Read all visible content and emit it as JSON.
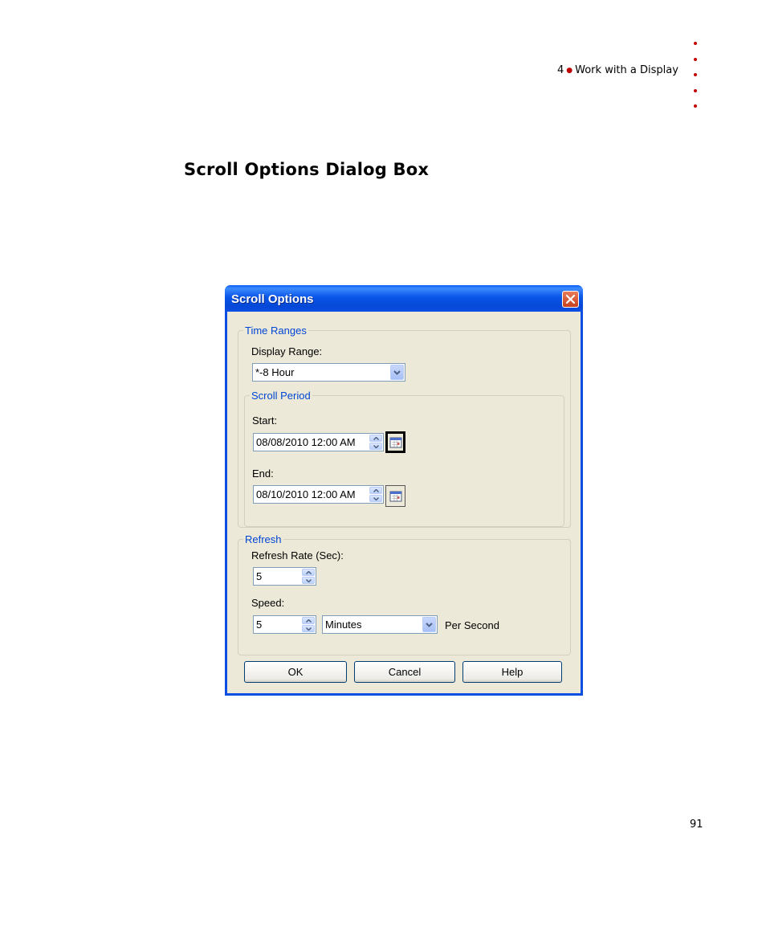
{
  "page_header": {
    "chapter_number": "4",
    "bullet": "●",
    "chapter_title": "Work with a Display"
  },
  "section_title": "Scroll Options Dialog Box",
  "page_number": "91",
  "dialog": {
    "title": "Scroll Options",
    "time_ranges": {
      "legend": "Time Ranges",
      "display_range_label": "Display Range:",
      "display_range_value": "*-8 Hour",
      "scroll_period": {
        "legend": "Scroll Period",
        "start_label": "Start:",
        "start_value": "08/08/2010 12:00 AM",
        "end_label": "End:",
        "end_value": "08/10/2010 12:00 AM"
      }
    },
    "refresh": {
      "legend": "Refresh",
      "rate_label": "Refresh Rate (Sec):",
      "rate_value": "5",
      "speed_label": "Speed:",
      "speed_value": "5",
      "speed_unit": "Minutes",
      "per_second_label": "Per Second"
    },
    "buttons": {
      "ok": "OK",
      "cancel": "Cancel",
      "help": "Help"
    }
  },
  "colors": {
    "accent_red": "#c00000",
    "titlebar_blue": "#0a4ee4",
    "dialog_bg": "#ece9d8",
    "legend_blue": "#0046d5"
  }
}
